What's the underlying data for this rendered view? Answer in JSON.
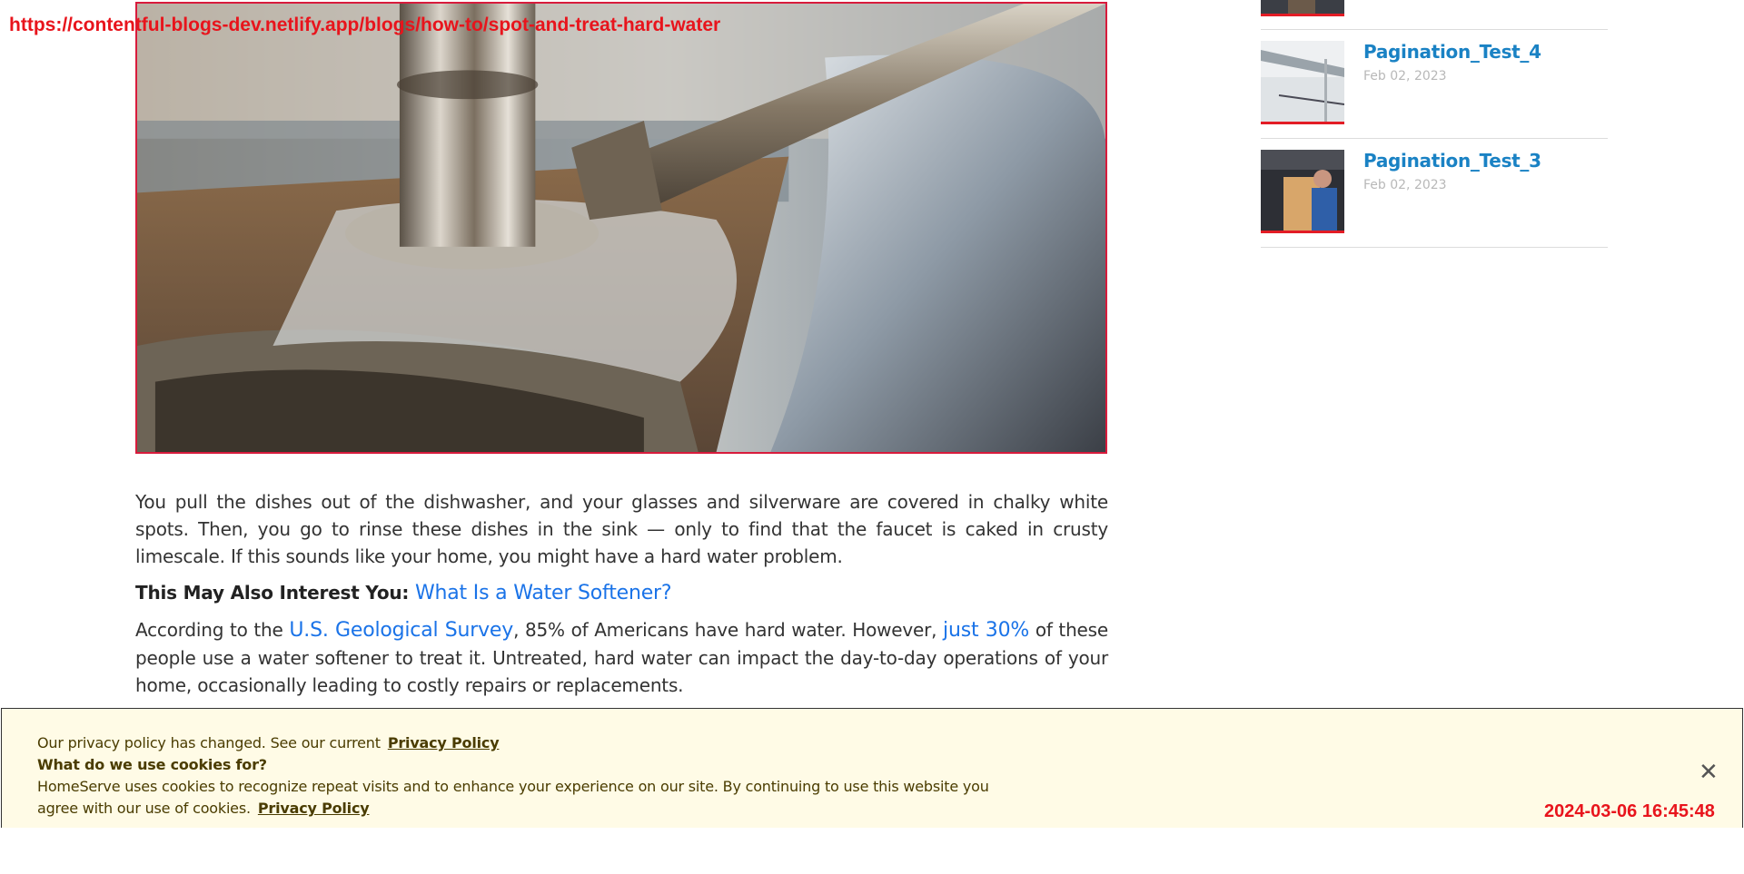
{
  "overlay": {
    "url": "https://contentful-blogs-dev.netlify.app/blogs/how-to/spot-and-treat-hard-water",
    "timestamp": "2024-03-06 16:45:48"
  },
  "article": {
    "paragraph1": "You pull the dishes out of the dishwasher, and your glasses and silverware are covered in chalky white spots. Then, you go to rinse these dishes in the sink — only to find that the faucet is caked in crusty limescale. If this sounds like your home, you might have a hard water problem.",
    "interest_prefix": "This May Also Interest You: ",
    "interest_link": "What Is a Water Softener?",
    "p2_a": "According to the ",
    "p2_link1": "U.S. Geological Survey",
    "p2_b": ", 85% of Americans have hard water. However, ",
    "p2_link2": "just 30%",
    "p2_c": " of these people use a water softener to treat it. Untreated, hard water can impact the day-to-day operations of your home, occasionally leading to costly repairs or replacements."
  },
  "sidebar": {
    "items": [
      {
        "title": "Pagination_Test_4",
        "date": "Feb 02, 2023"
      },
      {
        "title": "Pagination_Test_3",
        "date": "Feb 02, 2023"
      }
    ]
  },
  "cookie_banner": {
    "line1": "Our privacy policy has changed. See our current",
    "privacy_link": "Privacy Policy",
    "line2": "What do we use cookies for?",
    "line3": "HomeServe uses cookies to recognize repeat visits and to enhance your experience on our site. By continuing to use this website you",
    "line4": "agree with our use of cookies.",
    "close_icon": "close-icon"
  }
}
